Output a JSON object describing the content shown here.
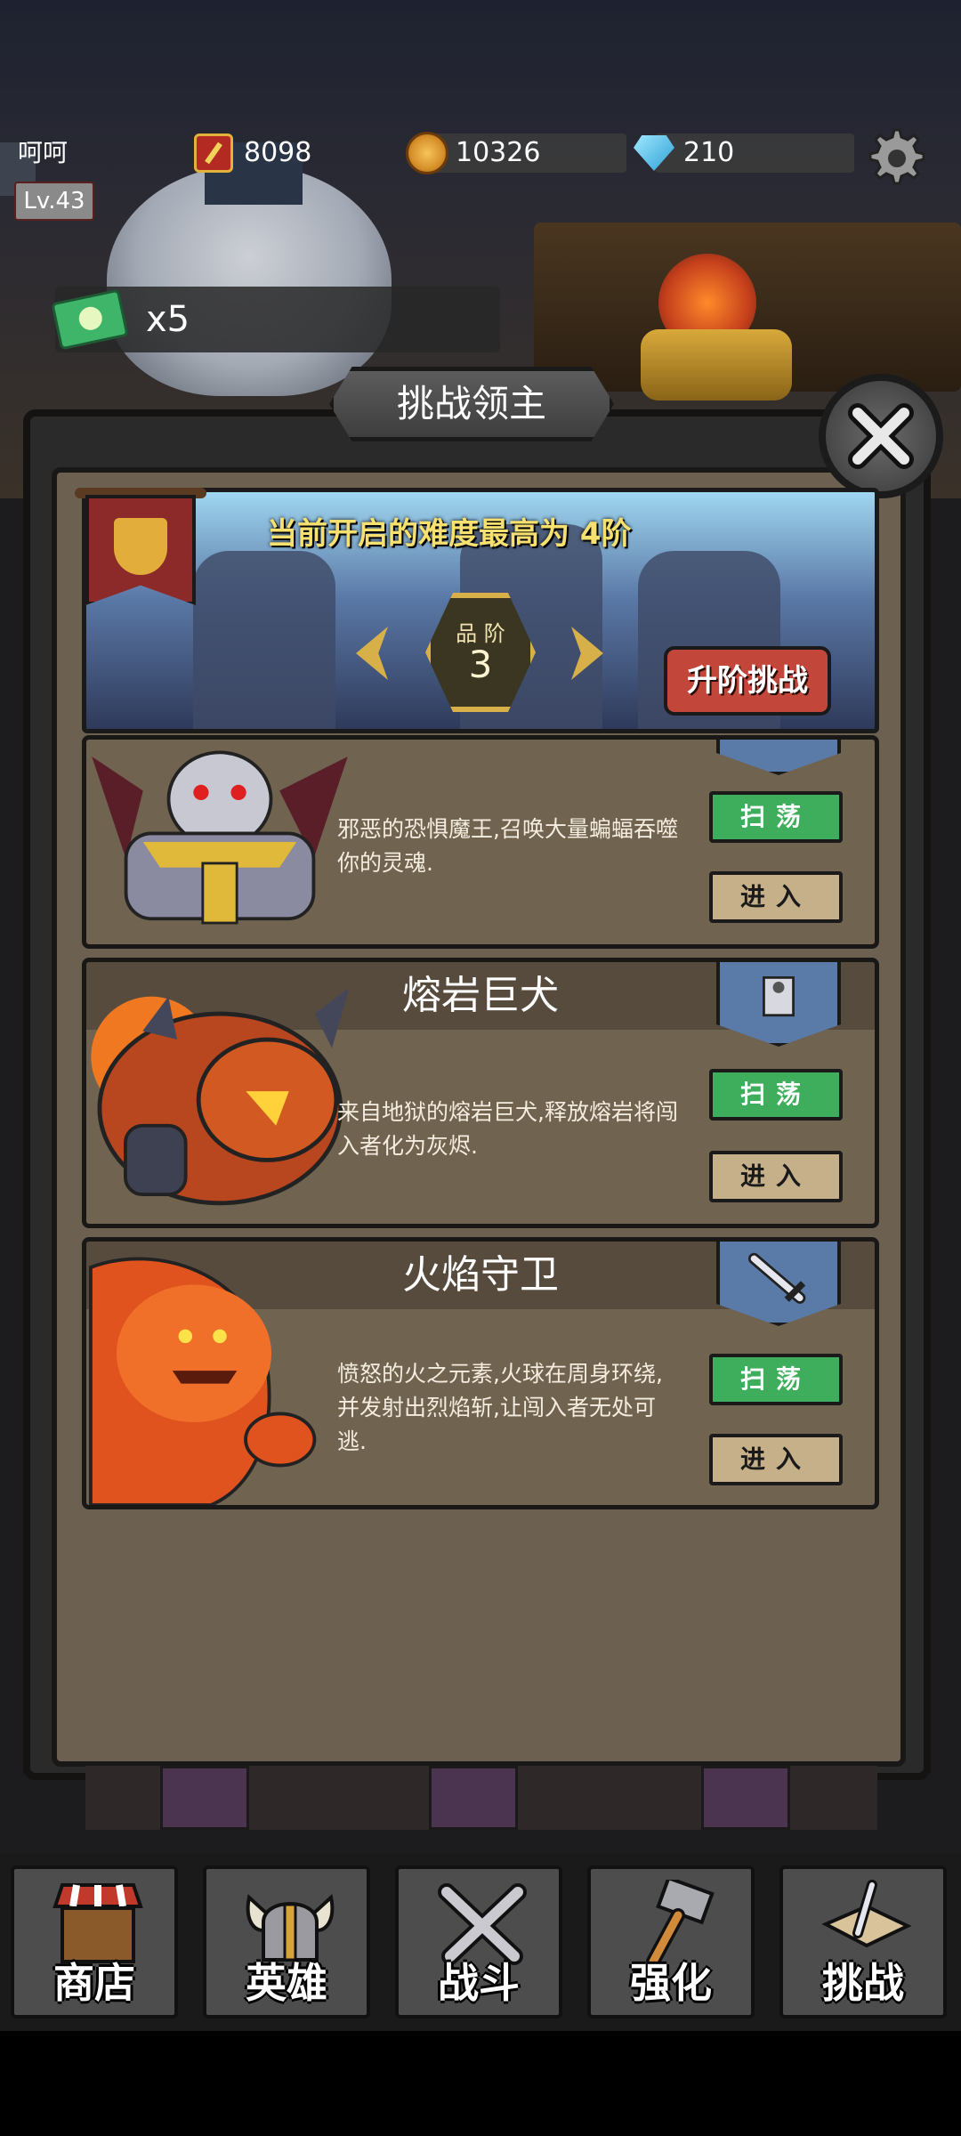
{
  "player": {
    "name": "呵呵",
    "level": "Lv.43"
  },
  "resources": {
    "power": "8098",
    "coins": "10326",
    "gems": "210"
  },
  "tickets": {
    "count": "x5"
  },
  "panel": {
    "title": "挑战领主"
  },
  "difficulty": {
    "note": "当前开启的难度最高为 4阶",
    "tier_label": "品 阶",
    "tier_value": "3",
    "upgrade_button": "升阶挑战"
  },
  "bosses": [
    {
      "name": "",
      "description": "邪恶的恐惧魔王,召唤大量蝙蝠吞噬你的灵魂.",
      "sweep": "扫荡",
      "enter": "进入",
      "tag_icon": "shield-icon"
    },
    {
      "name": "熔岩巨犬",
      "description": "来自地狱的熔岩巨犬,释放熔岩将闯入者化为灰烬.",
      "sweep": "扫荡",
      "enter": "进入",
      "tag_icon": "golem-icon"
    },
    {
      "name": "火焰守卫",
      "description": "愤怒的火之元素,火球在周身环绕,并发射出烈焰斩,让闯入者无处可逃.",
      "sweep": "扫荡",
      "enter": "进入",
      "tag_icon": "sword-icon"
    }
  ],
  "nav": {
    "shop": "商店",
    "heroes": "英雄",
    "battle": "战斗",
    "enhance": "强化",
    "challenge": "挑战"
  },
  "colors": {
    "accent_gold": "#d7b04a",
    "sweep_green": "#3fae5c",
    "upgrade_red": "#c2473a",
    "note_yellow": "#f5e070"
  }
}
